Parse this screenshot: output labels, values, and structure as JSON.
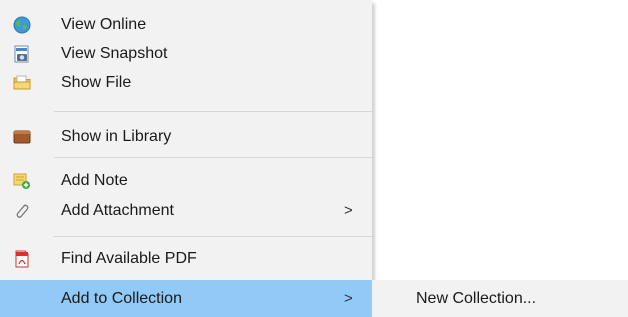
{
  "context_menu": {
    "items": [
      {
        "label": "View Online",
        "icon": "globe-icon"
      },
      {
        "label": "View Snapshot",
        "icon": "snapshot-icon"
      },
      {
        "label": "Show File",
        "icon": "folder-icon"
      },
      {
        "label": "Show in Library",
        "icon": "library-icon"
      },
      {
        "label": "Add Note",
        "icon": "note-add-icon"
      },
      {
        "label": "Add Attachment",
        "icon": "paperclip-icon",
        "submenu_arrow": ">"
      },
      {
        "label": "Find Available PDF",
        "icon": "pdf-icon"
      },
      {
        "label": "Add to Collection",
        "icon": "",
        "submenu_arrow": ">",
        "highlighted": true
      }
    ]
  },
  "submenu": {
    "items": [
      {
        "label": "New Collection..."
      }
    ]
  },
  "colors": {
    "menu_background": "#f2f2f2",
    "highlight": "#91c9f7",
    "separator": "#d7d7d7"
  }
}
